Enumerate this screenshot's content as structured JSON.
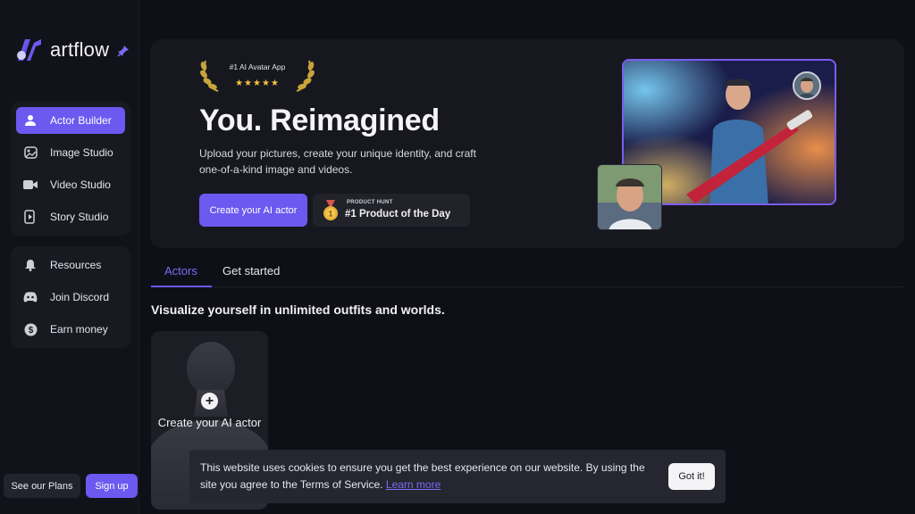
{
  "brand": {
    "name": "artflow",
    "accent": "#6b59f0"
  },
  "sidebar": {
    "primary": [
      {
        "label": "Actor Builder",
        "icon": "user-icon",
        "active": true
      },
      {
        "label": "Image Studio",
        "icon": "image-icon",
        "active": false
      },
      {
        "label": "Video Studio",
        "icon": "video-camera-icon",
        "active": false
      },
      {
        "label": "Story Studio",
        "icon": "story-icon",
        "active": false
      }
    ],
    "secondary": [
      {
        "label": "Resources",
        "icon": "bell-icon"
      },
      {
        "label": "Join Discord",
        "icon": "discord-icon"
      },
      {
        "label": "Earn money",
        "icon": "dollar-icon"
      }
    ],
    "see_plans": "See our Plans",
    "sign_up": "Sign up"
  },
  "hero": {
    "badge_title": "#1 AI Avatar App",
    "badge_stars": "★★★★★",
    "title": "You. Reimagined",
    "subtitle": "Upload your pictures, create your unique identity, and craft one-of-a-kind image and videos.",
    "cta": "Create your AI actor",
    "product_hunt": {
      "small": "PRODUCT HUNT",
      "big": "#1 Product of the Day"
    }
  },
  "tabs": [
    {
      "label": "Actors",
      "active": true
    },
    {
      "label": "Get started",
      "active": false
    }
  ],
  "section_title": "Visualize yourself in unlimited outfits and worlds.",
  "actor_card": {
    "label": "Create your AI actor"
  },
  "cookie": {
    "text": "This website uses cookies to ensure you get the best experience on our website. By using the site you agree to the Terms of Service.",
    "link": "Learn more",
    "button": "Got it!"
  }
}
